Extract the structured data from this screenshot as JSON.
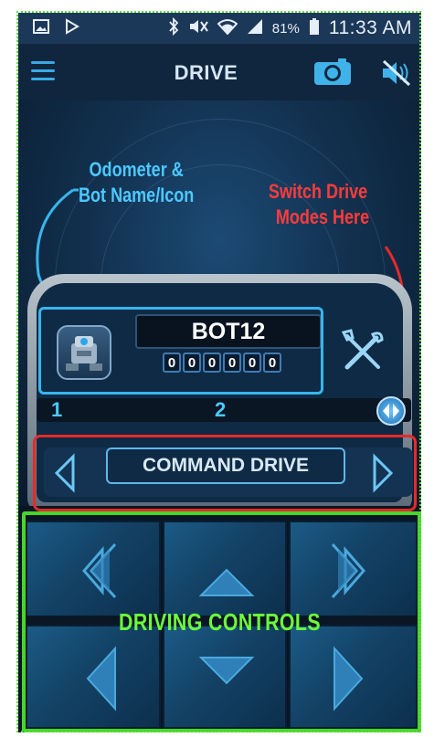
{
  "status_bar": {
    "battery_label": "81%",
    "time": "11:33 AM",
    "icons": [
      "gallery-icon",
      "play-store-icon",
      "bluetooth-icon",
      "mute-icon",
      "wifi-icon",
      "signal-icon",
      "battery-icon"
    ]
  },
  "app_bar": {
    "title": "DRIVE",
    "icons": [
      "hamburger-menu-icon",
      "camera-icon",
      "sound-muted-icon"
    ]
  },
  "annotations": {
    "odometer_note_line1": "Odometer &",
    "odometer_note_line2": "Bot Name/Icon",
    "switch_note_line1": "Switch Drive",
    "switch_note_line2": "Modes Here",
    "controls_note": "DRIVING CONTROLS"
  },
  "bot": {
    "name": "BOT12",
    "odometer_digits": [
      "0",
      "0",
      "0",
      "0",
      "0",
      "0"
    ]
  },
  "gear": {
    "gear1": "1",
    "gear2": "2"
  },
  "drive_mode": {
    "label": "COMMAND DRIVE"
  },
  "colors": {
    "annotation_blue": "#37b5ec",
    "annotation_red": "#e62a2a",
    "annotation_green": "#47d62a",
    "accent": "#3aa9e6"
  }
}
